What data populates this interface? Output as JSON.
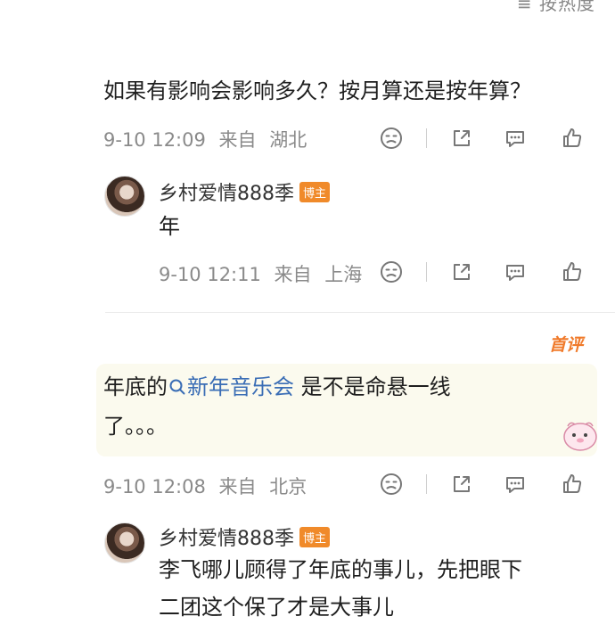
{
  "header": {
    "sort_label": "≡ 按热度"
  },
  "comments": [
    {
      "text": "如果有影响会影响多久？按月算还是按年算？",
      "date": "9-10 12:09",
      "from": "来自",
      "location": "湖北",
      "reply": {
        "username": "乡村爱情888季",
        "badge": "博主",
        "text": "年",
        "date": "9-10 12:11",
        "from": "来自",
        "location": "上海"
      }
    },
    {
      "first_badge": "首评",
      "text_before": "年底的",
      "topic": "新年音乐会",
      "text_after": " 是不是命悬一线",
      "text_line2": "了。。。",
      "date": "9-10 12:08",
      "from": "来自",
      "location": "北京",
      "reply": {
        "username": "乡村爱情888季",
        "badge": "博主",
        "text_line1": "李飞哪儿顾得了年底的事儿，先把眼下",
        "text_line2": "二团这个保了才是大事儿"
      }
    }
  ],
  "icons": [
    "dislike-icon",
    "share-icon",
    "comment-icon",
    "like-icon",
    "search-icon"
  ],
  "colors": {
    "topic_link": "#3a6db5",
    "badge": "#f08a2a",
    "meta_gray": "#8a8a8a"
  }
}
